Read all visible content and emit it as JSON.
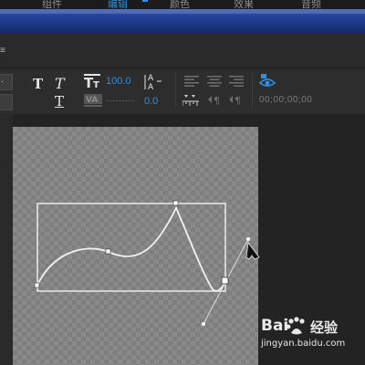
{
  "top_tabs": [
    {
      "label": "组件",
      "active": false
    },
    {
      "label": "编辑",
      "active": true
    },
    {
      "label": "颜色",
      "active": false
    },
    {
      "label": "效果",
      "active": false
    },
    {
      "label": "音频",
      "active": false
    }
  ],
  "panel": {
    "left_marker": "≡"
  },
  "toolbar": {
    "font_dropdown_value": ".",
    "font_size_value": "100.0",
    "kerning_value": "---------",
    "baseline_value": "0.0",
    "timecode": "00;00;00;00"
  },
  "icons": {
    "bold": "bold-T-icon",
    "italic": "italic-T-icon",
    "underline": "underline-T-icon",
    "font_size": "font-size-icon",
    "leading": "leading-icon",
    "kerning": "kerning-va-icon",
    "baseline": "baseline-shift-icon",
    "eye": "eye-icon",
    "pen": "pen-cursor-icon"
  },
  "colors": {
    "accent": "#2f8fe3",
    "title_bar": "#203a8a",
    "path_stroke": "#f2f2f2"
  },
  "watermark": {
    "brand_left": "Bai",
    "brand_right": "经验",
    "url": "jingyan.baidu.com"
  }
}
